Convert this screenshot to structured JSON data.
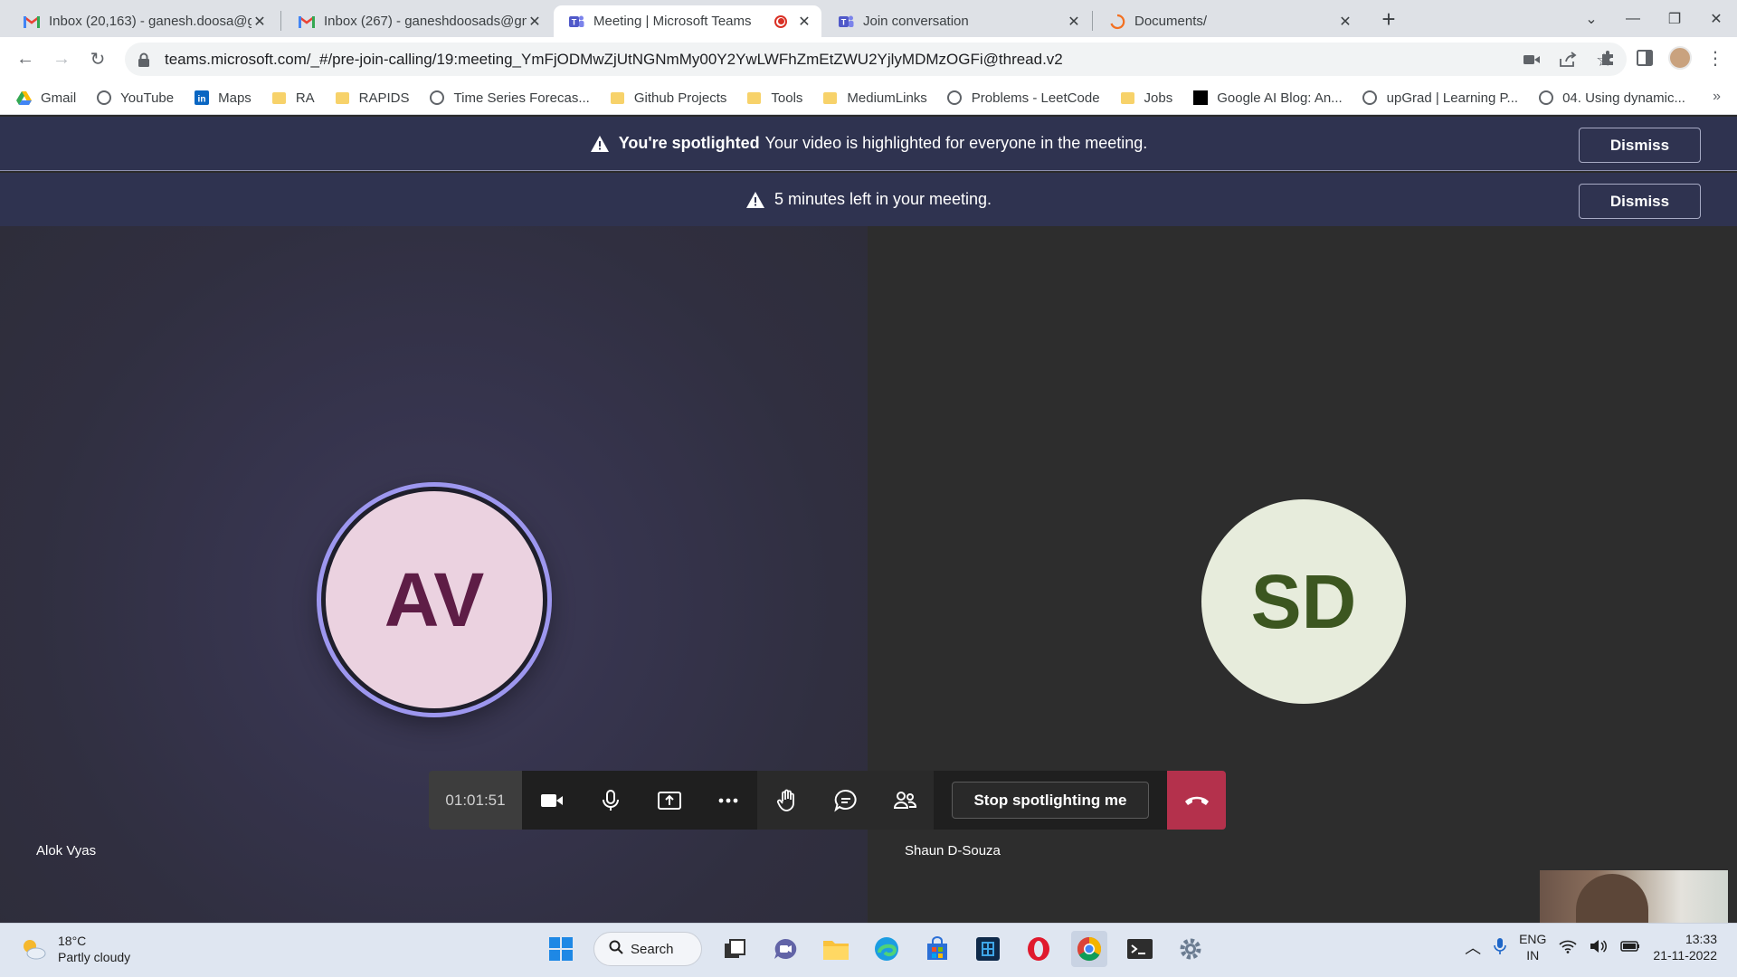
{
  "browser": {
    "tabs": [
      {
        "title": "Inbox (20,163) - ganesh.doosa@g",
        "icon": "gmail-icon"
      },
      {
        "title": "Inbox (267) - ganeshdoosads@gm",
        "icon": "gmail-icon"
      },
      {
        "title": "Meeting | Microsoft Teams",
        "icon": "teams-icon",
        "active": true
      },
      {
        "title": "Join conversation",
        "icon": "teams-icon"
      },
      {
        "title": "Documents/",
        "icon": "loading-icon"
      }
    ],
    "url": "teams.microsoft.com/_#/pre-join-calling/19:meeting_YmFjODMwZjUtNGNmMy00Y2YwLWFhZmEtZWU2YjlyMDMzOGFi@thread.v2",
    "bookmarks": [
      {
        "label": "Gmail",
        "icon": "google-drive-icon"
      },
      {
        "label": "YouTube",
        "icon": "globe-icon"
      },
      {
        "label": "Maps",
        "icon": "linkedin-icon"
      },
      {
        "label": "RA",
        "icon": "folder-icon"
      },
      {
        "label": "RAPIDS",
        "icon": "folder-icon"
      },
      {
        "label": "Time Series Forecas...",
        "icon": "globe-icon"
      },
      {
        "label": "Github Projects",
        "icon": "folder-icon"
      },
      {
        "label": "Tools",
        "icon": "folder-icon"
      },
      {
        "label": "MediumLinks",
        "icon": "folder-icon"
      },
      {
        "label": "Problems - LeetCode",
        "icon": "globe-icon"
      },
      {
        "label": "Jobs",
        "icon": "folder-icon"
      },
      {
        "label": "Google AI Blog: An...",
        "icon": "uber-icon"
      },
      {
        "label": "upGrad | Learning P...",
        "icon": "globe-icon"
      },
      {
        "label": "04. Using dynamic...",
        "icon": "globe-icon"
      }
    ],
    "bookmarks_more": "»"
  },
  "banners": {
    "spotlight_bold": "You're spotlighted",
    "spotlight_text": "Your video is highlighted for everyone in the meeting.",
    "time_text": "5 minutes left in your meeting.",
    "dismiss_label": "Dismiss"
  },
  "participants": [
    {
      "initials": "AV",
      "name": "Alok Vyas"
    },
    {
      "initials": "SD",
      "name": "Shaun D-Souza"
    }
  ],
  "controls": {
    "timer": "01:01:51",
    "stop_spotlight_label": "Stop spotlighting me"
  },
  "taskbar": {
    "temperature": "18°C",
    "weather": "Partly cloudy",
    "search_label": "Search",
    "lang_top": "ENG",
    "lang_bottom": "IN",
    "time": "13:33",
    "date": "21-11-2022"
  },
  "colors": {
    "banner_bg": "#2f3350",
    "hangup": "#b4314c",
    "av_avatar": "#ebd2e0",
    "sd_avatar": "#e7ecdc",
    "speaking_ring": "#9d97ef"
  }
}
